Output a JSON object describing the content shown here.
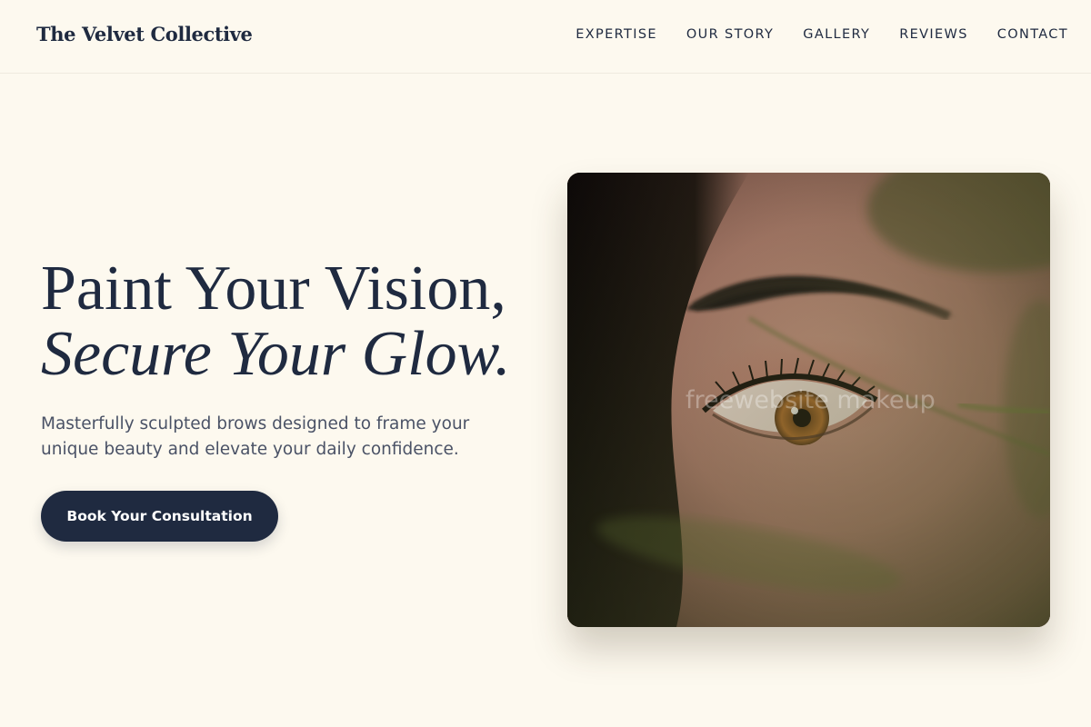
{
  "header": {
    "brand": "The Velvet Collective",
    "nav": [
      "EXPERTISE",
      "OUR STORY",
      "GALLERY",
      "REVIEWS",
      "CONTACT"
    ]
  },
  "hero": {
    "title_line1": "Paint Your Vision,",
    "title_line2": "Secure Your Glow.",
    "subtitle": "Masterfully sculpted brows designed to frame your unique beauty and elevate your daily confidence.",
    "cta_label": "Book Your Consultation"
  },
  "image": {
    "alt": "Close-up photo of a woman's eye with a sculpted brow",
    "watermark": "freewebsite makeup"
  },
  "colors": {
    "background": "#fdf9ef",
    "primary": "#1f2a40",
    "body_text": "#4a5266"
  }
}
